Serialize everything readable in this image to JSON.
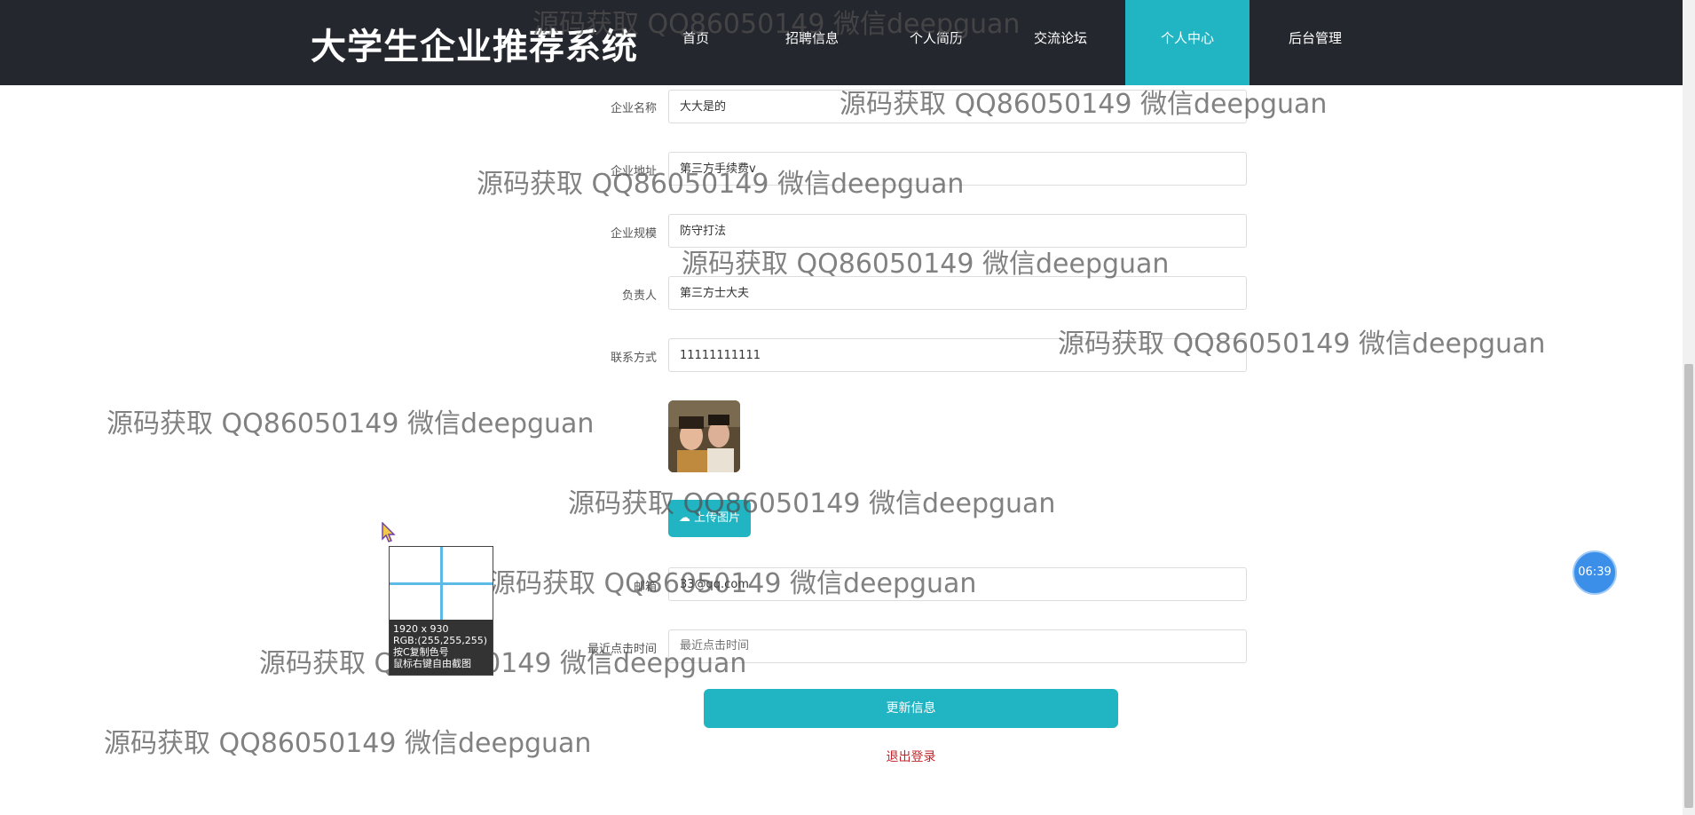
{
  "header": {
    "brand": "大学生企业推荐系统",
    "nav": [
      {
        "label": "首页"
      },
      {
        "label": "招聘信息"
      },
      {
        "label": "个人简历"
      },
      {
        "label": "交流论坛"
      },
      {
        "label": "个人中心",
        "active": true
      },
      {
        "label": "后台管理"
      }
    ]
  },
  "form": {
    "fields": [
      {
        "label": "企业名称",
        "value": "大大是的",
        "placeholder": ""
      },
      {
        "label": "企业地址",
        "value": "第三方手续费v",
        "placeholder": ""
      },
      {
        "label": "企业规模",
        "value": "防守打法",
        "placeholder": ""
      },
      {
        "label": "负责人",
        "value": "第三方士大夫",
        "placeholder": ""
      },
      {
        "label": "联系方式",
        "value": "11111111111",
        "placeholder": ""
      },
      {
        "label": "邮箱",
        "value": "33@qq.com",
        "placeholder": ""
      },
      {
        "label": "最近点击时间",
        "value": "",
        "placeholder": "最近点击时间"
      }
    ],
    "upload_label": "上传图片",
    "submit_label": "更新信息",
    "logout_label": "退出登录"
  },
  "watermark_text": "源码获取 QQ86050149 微信deepguan",
  "timer": "06:39",
  "color_picker": {
    "line1": "1920 x 930",
    "line2": "RGB:(255,255,255)",
    "line3": "按C复制色号",
    "line4": "鼠标右键自由截图"
  },
  "colors": {
    "header_bg": "#24272d",
    "accent": "#21b5c4",
    "logout": "#c0242b"
  }
}
